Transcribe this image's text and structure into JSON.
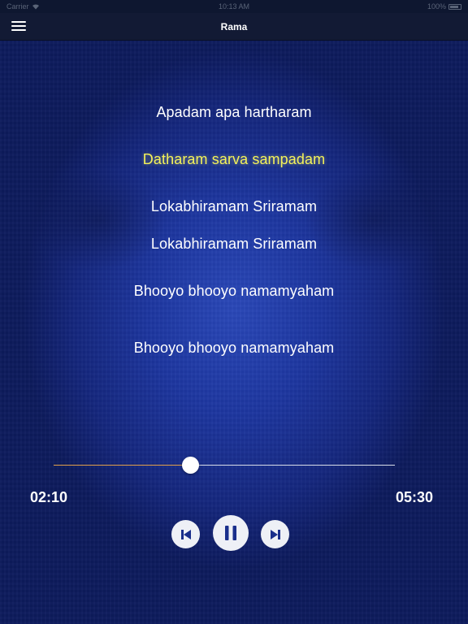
{
  "status_bar": {
    "carrier": "Carrier",
    "time": "10:13 AM",
    "battery": "100%"
  },
  "nav": {
    "title": "Rama",
    "menu_icon": "hamburger-menu-icon"
  },
  "lyrics": [
    {
      "text": "Apadam apa hartharam",
      "active": false
    },
    {
      "text": "Datharam sarva sampadam",
      "active": true
    },
    {
      "text": "Lokabhiramam Sriramam",
      "active": false
    },
    {
      "text": "Lokabhiramam Sriramam",
      "active": false
    },
    {
      "text": "Bhooyo bhooyo namamyaham",
      "active": false
    },
    {
      "text": "Bhooyo bhooyo namamyaham",
      "active": false
    }
  ],
  "player": {
    "elapsed": "02:10",
    "total": "05:30",
    "progress": 0.4,
    "controls": {
      "previous_icon": "skip-previous-icon",
      "pause_icon": "pause-icon",
      "next_icon": "skip-next-icon"
    }
  },
  "colors": {
    "active_lyric": "#f4f25a",
    "lyric": "#ffffff",
    "progress_fill": "#e2a04a",
    "progress_track": "#d8dde8",
    "nav_background": "#121a34"
  }
}
